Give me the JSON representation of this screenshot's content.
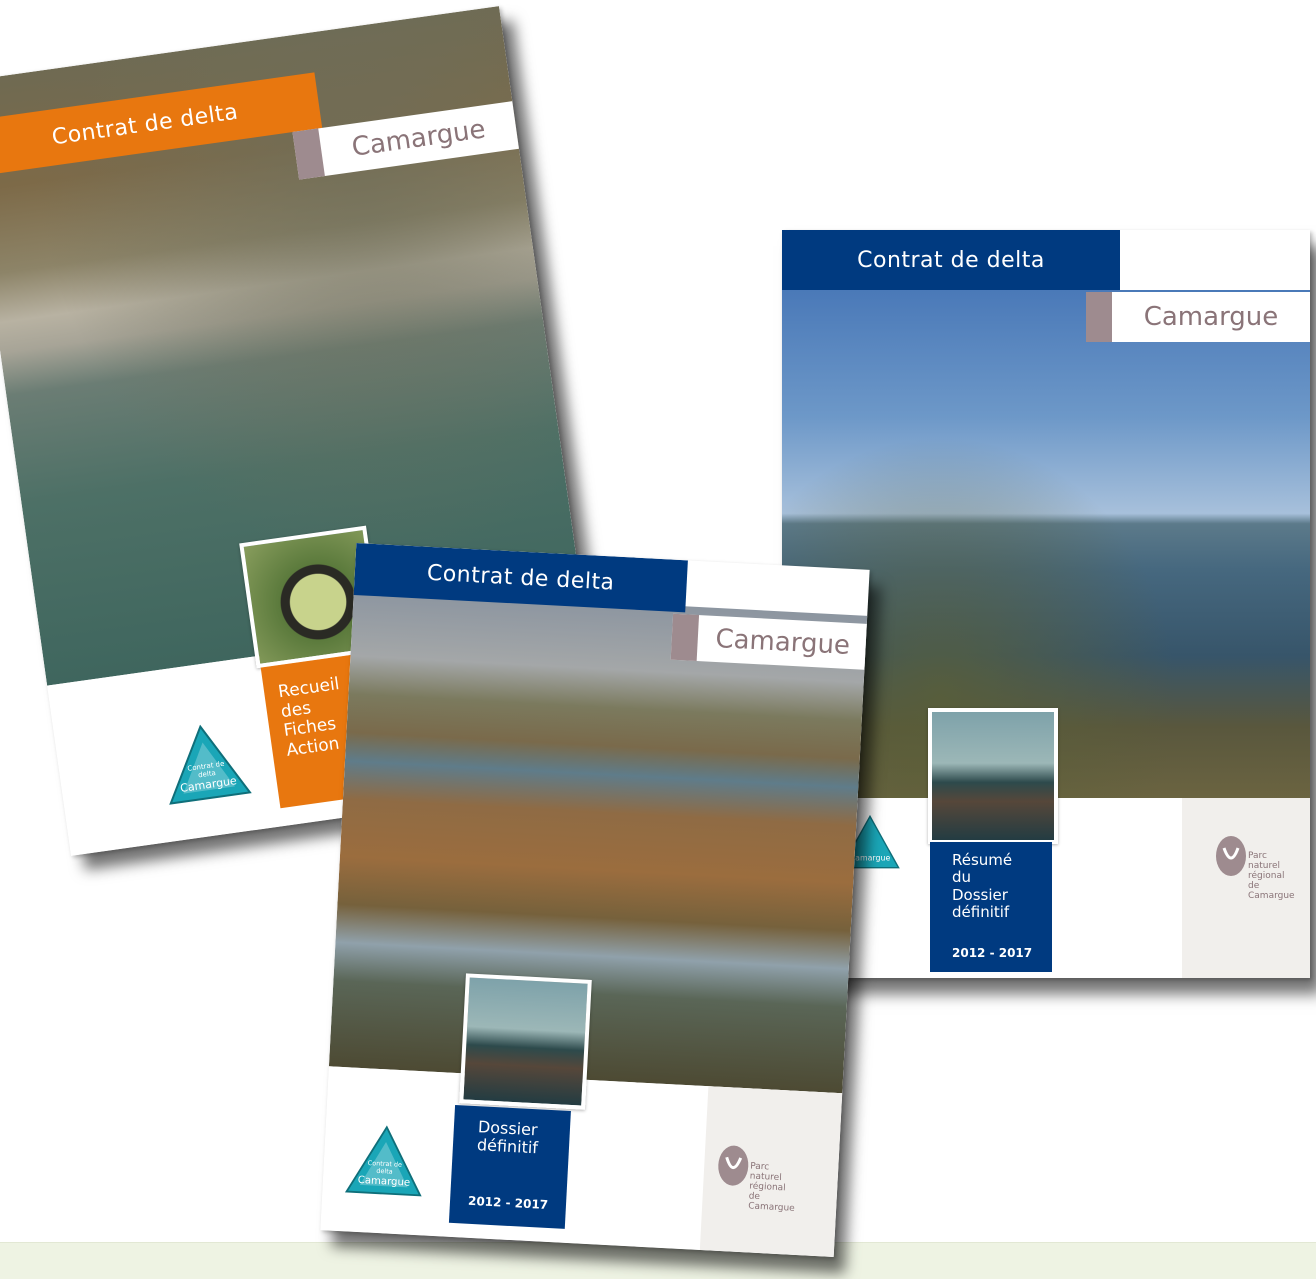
{
  "covers": [
    {
      "id": "recueil",
      "band_title": "Contrat de delta",
      "subtitle": "Camargue",
      "label_lines": [
        "Recueil",
        "des",
        "Fiches",
        "Action"
      ],
      "band_color": "#e8770f"
    },
    {
      "id": "resume",
      "band_title": "Contrat de delta",
      "subtitle": "Camargue",
      "label_lines": [
        "Résumé",
        "du",
        "Dossier",
        "définitif"
      ],
      "years": "2012 - 2017",
      "parc_lines": [
        "Parc",
        "naturel",
        "régional",
        "de Camargue"
      ],
      "band_color": "#003a80"
    },
    {
      "id": "dossier",
      "band_title": "Contrat de delta",
      "subtitle": "Camargue",
      "label_lines": [
        "Dossier",
        "définitif"
      ],
      "years": "2012 - 2017",
      "parc_lines": [
        "Parc",
        "naturel",
        "régional",
        "de Camargue"
      ],
      "band_color": "#003a80"
    }
  ],
  "logo": {
    "lines": [
      "Contrat de",
      "delta",
      "Camargue"
    ],
    "color": "#1aa6b7"
  },
  "colors": {
    "subtitle_accent": "#9e8b8f",
    "bottom_band": "#eef3e3"
  }
}
